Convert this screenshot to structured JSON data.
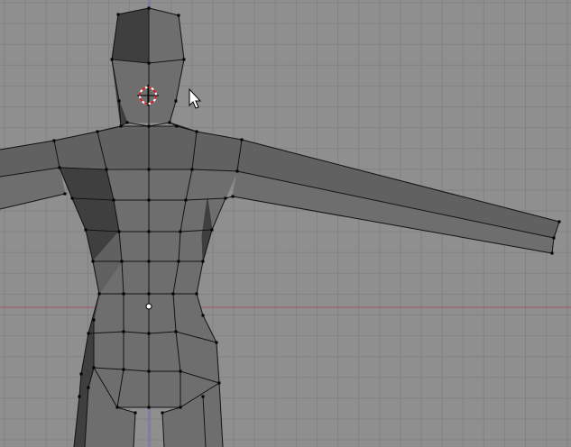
{
  "viewport": {
    "mode": "edit-mode",
    "view": "front-orthographic",
    "background_color": "#8f8f8f",
    "grid_color": "#828282",
    "x_axis_color": "#a05560",
    "z_axis_color": "#6a6ad0"
  },
  "mesh": {
    "name": "humanoid-half-mesh",
    "face_light": "#6e6e6e",
    "face_mid": "#616161",
    "face_dark": "#3f3f3f",
    "edge_color": "#141414",
    "vertex_color": "#000000",
    "pivot_color": "#ffffff"
  },
  "cursor_3d": {
    "ring_red": "#d01818",
    "ring_white": "#ffffff"
  },
  "mouse_pointer": {
    "icon": "arrow-cursor-icon"
  }
}
